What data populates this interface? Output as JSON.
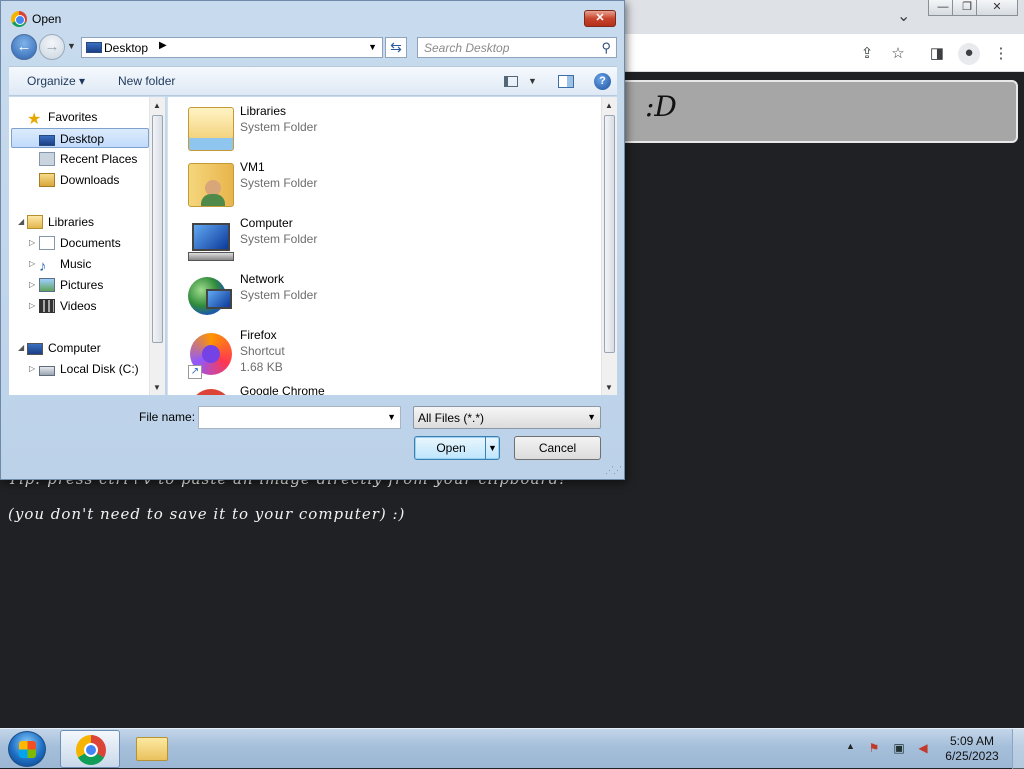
{
  "browser": {
    "window_controls": {
      "chevron": "⌄",
      "minimize": "—",
      "restore": "❐",
      "close": "✕"
    },
    "toolbar_icons": [
      "share-icon",
      "star-icon",
      "sidebar-icon",
      "profile-icon",
      "menu-icon"
    ]
  },
  "page": {
    "doodle_text": ":D",
    "hint_line1": "Tip: press ctrl+v to paste an image directly from your clipboard!",
    "hint_line2": "(you don't need to save it to your computer) :)"
  },
  "dialog": {
    "title": "Open",
    "close_label": "✕",
    "address": {
      "location": "Desktop",
      "separator": "▶"
    },
    "search": {
      "placeholder": "Search Desktop"
    },
    "commands": {
      "organize": "Organize ▾",
      "new_folder": "New folder",
      "help": "?"
    },
    "nav_pane": {
      "favorites": "Favorites",
      "desktop": "Desktop",
      "recent_places": "Recent Places",
      "downloads": "Downloads",
      "libraries": "Libraries",
      "documents": "Documents",
      "music": "Music",
      "pictures": "Pictures",
      "videos": "Videos",
      "computer": "Computer",
      "local_disk": "Local Disk (C:)"
    },
    "files": [
      {
        "name": "Libraries",
        "type": "System Folder",
        "size": ""
      },
      {
        "name": "VM1",
        "type": "System Folder",
        "size": ""
      },
      {
        "name": "Computer",
        "type": "System Folder",
        "size": ""
      },
      {
        "name": "Network",
        "type": "System Folder",
        "size": ""
      },
      {
        "name": "Firefox",
        "type": "Shortcut",
        "size": "1.68 KB"
      },
      {
        "name": "Google Chrome",
        "type": "",
        "size": ""
      }
    ],
    "file_name_label": "File name:",
    "file_name_value": "",
    "file_type": "All Files (*.*)",
    "open_button": "Open",
    "cancel_button": "Cancel"
  },
  "taskbar": {
    "clock_time": "5:09 AM",
    "clock_date": "6/25/2023"
  }
}
